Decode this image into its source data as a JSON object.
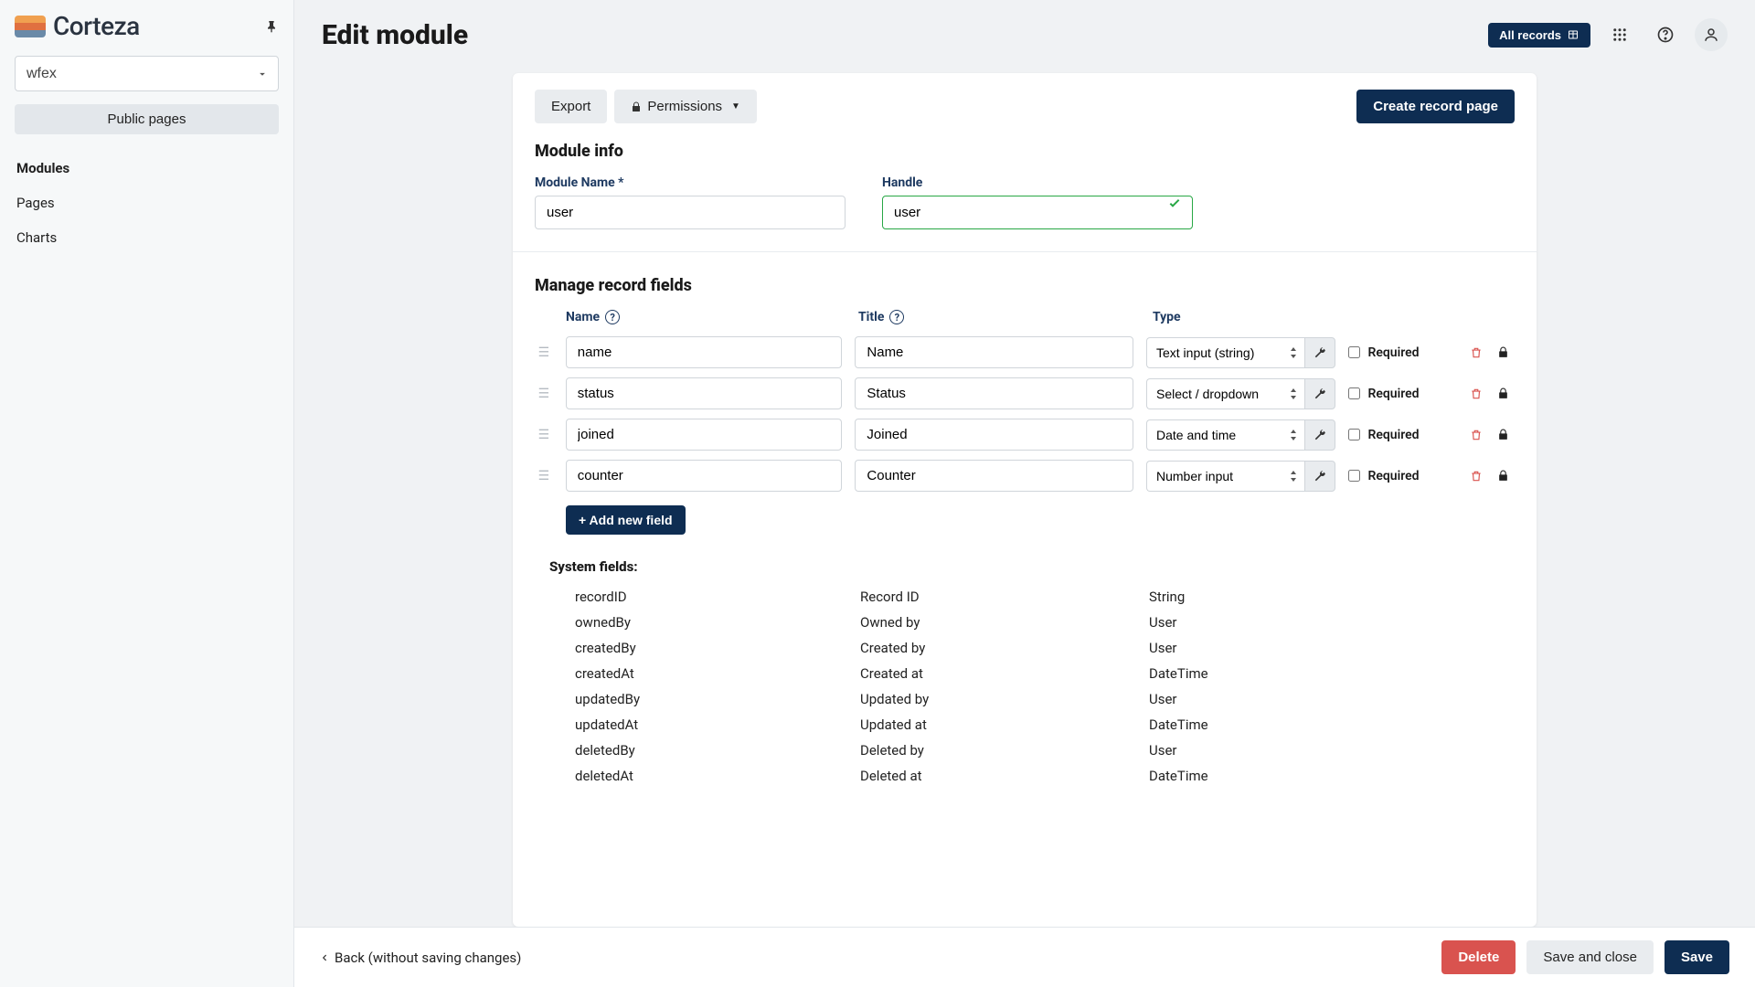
{
  "brand": "Corteza",
  "namespace": {
    "selected": "wfex"
  },
  "sidebar": {
    "public_pages": "Public pages",
    "nav": [
      {
        "label": "Modules",
        "active": true
      },
      {
        "label": "Pages",
        "active": false
      },
      {
        "label": "Charts",
        "active": false
      }
    ]
  },
  "header": {
    "title": "Edit module",
    "all_records": "All records"
  },
  "card": {
    "export": "Export",
    "permissions": "Permissions",
    "create_record_page": "Create record page",
    "module_info_title": "Module info",
    "module_name_label": "Module Name *",
    "module_name_value": "user",
    "handle_label": "Handle",
    "handle_value": "user",
    "manage_fields_title": "Manage record fields",
    "columns": {
      "name": "Name",
      "title": "Title",
      "type": "Type"
    },
    "required_label": "Required",
    "add_field": "+ Add new field",
    "fields": [
      {
        "name": "name",
        "title": "Name",
        "type": "Text input (string)",
        "required": false
      },
      {
        "name": "status",
        "title": "Status",
        "type": "Select / dropdown",
        "required": false
      },
      {
        "name": "joined",
        "title": "Joined",
        "type": "Date and time",
        "required": false
      },
      {
        "name": "counter",
        "title": "Counter",
        "type": "Number input",
        "required": false
      }
    ],
    "system_fields_title": "System fields:",
    "system_fields": [
      {
        "name": "recordID",
        "title": "Record ID",
        "type": "String"
      },
      {
        "name": "ownedBy",
        "title": "Owned by",
        "type": "User"
      },
      {
        "name": "createdBy",
        "title": "Created by",
        "type": "User"
      },
      {
        "name": "createdAt",
        "title": "Created at",
        "type": "DateTime"
      },
      {
        "name": "updatedBy",
        "title": "Updated by",
        "type": "User"
      },
      {
        "name": "updatedAt",
        "title": "Updated at",
        "type": "DateTime"
      },
      {
        "name": "deletedBy",
        "title": "Deleted by",
        "type": "User"
      },
      {
        "name": "deletedAt",
        "title": "Deleted at",
        "type": "DateTime"
      }
    ]
  },
  "footer": {
    "back": "Back (without saving changes)",
    "delete": "Delete",
    "save_close": "Save and close",
    "save": "Save"
  }
}
